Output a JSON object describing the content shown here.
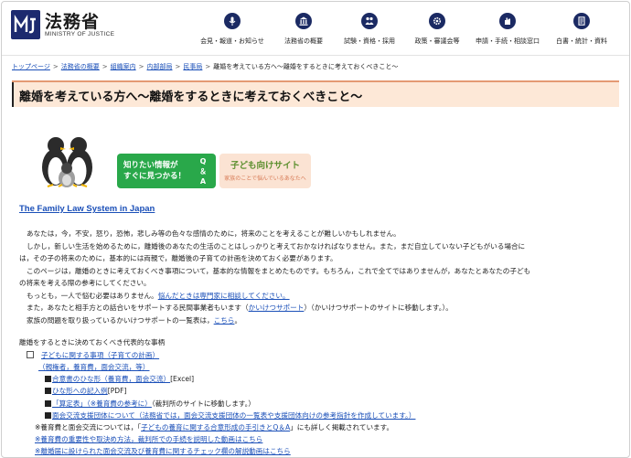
{
  "header": {
    "site_name": "法務省",
    "site_sub": "MINISTRY OF JUSTICE",
    "nav": [
      {
        "label": "会見・報道・お知らせ",
        "icon": "microphone-icon"
      },
      {
        "label": "法務省の概要",
        "icon": "building-icon"
      },
      {
        "label": "試験・資格・採用",
        "icon": "people-icon"
      },
      {
        "label": "政策・審議会等",
        "icon": "gear-icon"
      },
      {
        "label": "申請・手続・相談窓口",
        "icon": "hand-icon"
      },
      {
        "label": "白書・統計・資料",
        "icon": "document-icon"
      }
    ]
  },
  "breadcrumb": {
    "items": [
      "トップページ",
      "法務省の概要",
      "組織案内",
      "内部部局",
      "民事局"
    ],
    "current": "離婚を考えている方へ～離婚をするときに考えておくべきこと～",
    "sep": ">"
  },
  "title": "離婚を考えている方へ～離婚をするときに考えておくべきこと～",
  "banner": {
    "qa_main": "知りたい情報が\nすぐに見つかる！",
    "qa_side": "Q＆A",
    "kids_main": "子ども向けサイト",
    "kids_sub": "家族のことで悩んでいるあなたへ"
  },
  "family_link": "The Family Law System in Japan",
  "paragraphs": {
    "p1": "あなたは，今，不安，怒り，恐怖，悲しみ等の色々な感情のために，将来のことを考えることが難しいかもしれません。",
    "p2a": "しかし，新しい生活を始めるために，離婚後のあなたの生活のことはしっかりと考えておかなければなりません。また，まだ自立していない子どもがいる場合に",
    "p2b": "は，その子の将来のために，基本的には両親で，離婚後の子育ての計画を決めておく必要があります。",
    "p3a": "このページは，離婚のときに考えておくべき事項について，基本的な情報をまとめたものです。もちろん，これで全てではありませんが，あなたとあなたの子ども",
    "p3b": "の将来を考える際の参考にしてください。",
    "p4_pre": "もっとも，一人で悩む必要はありません。",
    "p4_link": "悩んだときは専門家に相談してください。",
    "p5_pre": "また，あなたと相手方との話合いをサポートする民間事業者もいます（",
    "p5_link": "かいけつサポート",
    "p5_post": "）（かいけつサポートのサイトに移動します。）。",
    "p6_pre": "家族の問題を取り扱っているかいけつサポートの一覧表は，",
    "p6_link": "こちら",
    "p6_post": "。"
  },
  "section": {
    "heading": "離婚をするときに決めておくべき代表的な事柄",
    "item1": "子どもに関する事項（子育ての計画）",
    "item1_sub": "（親権者，養育費，面会交流，等）",
    "sub1_link": "合意書のひな形（養育費，面会交流）",
    "sub1_post": "[Excel]",
    "sub2_link": "ひな形への記入例",
    "sub2_post": "[PDF]",
    "sub3_link": "「算定表」（※養育費の参考に）",
    "sub3_post": "（裁判所のサイトに移動します。）",
    "sub4_link": "面会交流支援団体について（法務省では，面会交流支援団体の一覧表や支援団体向けの参考指針を作成しています。）",
    "note1_pre": "※養育費と面会交流については，「",
    "note1_link": "子どもの養育に関する合意形成の手引きとQ＆A",
    "note1_post": "」にも詳しく掲載されています。",
    "note2": "※養育費の重要性や取決め方法，裁判所での手続を説明した動画はこちら",
    "note3": "※離婚届に設けられた面会交流及び養育費に関するチェック欄の解説動画はこちら"
  },
  "colors": {
    "navy": "#1d2a6f",
    "title_bg": "#fde8d7",
    "qa_green": "#29a84a",
    "link": "#1a4fb8"
  }
}
